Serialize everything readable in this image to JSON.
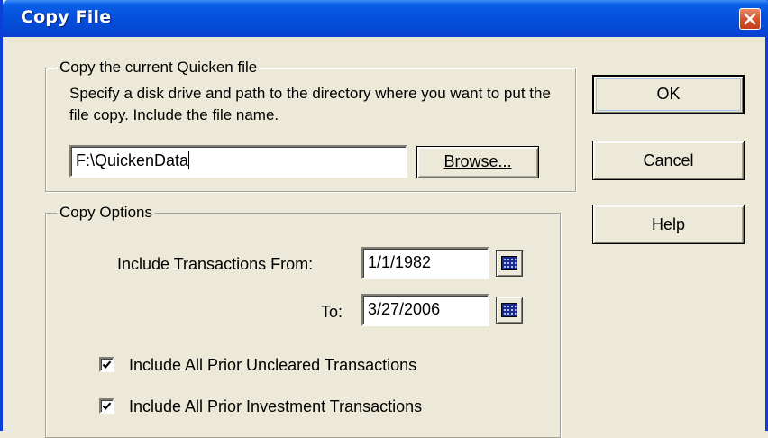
{
  "window": {
    "title": "Copy File"
  },
  "copy_group": {
    "legend": "Copy the current Quicken file",
    "description": "Specify a disk drive and path to the directory where you want to put the file copy. Include the file name.",
    "path_value": "F:\\QuickenData",
    "browse_label": "Browse..."
  },
  "options_group": {
    "legend": "Copy Options",
    "from_label": "Include Transactions From:",
    "from_value": "1/1/1982",
    "to_label": "To:",
    "to_value": "3/27/2006",
    "checkboxes": [
      {
        "label": "Include All Prior Uncleared Transactions",
        "checked": true
      },
      {
        "label": "Include All Prior Investment Transactions",
        "checked": true
      }
    ]
  },
  "buttons": {
    "ok": "OK",
    "cancel": "Cancel",
    "help": "Help"
  },
  "icons": {
    "close": "close-icon",
    "calendar": "calendar-icon",
    "check": "checkmark-icon"
  },
  "colors": {
    "titlebar": "#0651dc",
    "close": "#d5532d",
    "face": "#ece9d8"
  }
}
